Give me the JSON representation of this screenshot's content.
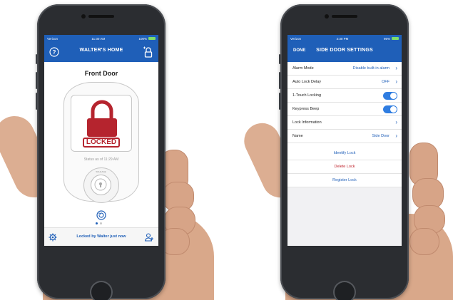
{
  "left_phone": {
    "status_bar": {
      "carrier": "Verizon",
      "time": "11:30 AM",
      "battery": "100%"
    },
    "header": {
      "title": "WALTER'S HOME",
      "left_icon": "help-icon",
      "right_icon": "add-lock-icon"
    },
    "lock": {
      "name": "Front Door",
      "state_label": "LOCKED",
      "status_text": "Status as of 11:29 AM",
      "keypad_label": "SCHLAGE"
    },
    "footer": {
      "status": "Locked by Walter just now",
      "left_icon": "gear-icon",
      "right_icon": "users-icon"
    },
    "pager": {
      "pages": 2,
      "active": 1
    }
  },
  "right_phone": {
    "status_bar": {
      "carrier": "Verizon",
      "time": "2:30 PM",
      "battery": "95%"
    },
    "header": {
      "done_label": "DONE",
      "title": "SIDE DOOR SETTINGS"
    },
    "settings": [
      {
        "label": "Alarm Mode",
        "value": "Disable built-in alarm",
        "control": "chevron"
      },
      {
        "label": "Auto Lock Delay",
        "value": "OFF",
        "control": "chevron"
      },
      {
        "label": "1-Touch Locking",
        "value": "",
        "control": "toggle",
        "on": true
      },
      {
        "label": "Keypress Beep",
        "value": "",
        "control": "toggle",
        "on": true
      },
      {
        "label": "Lock Information",
        "value": "",
        "control": "chevron"
      },
      {
        "label": "Name",
        "value": "Side Door",
        "control": "chevron"
      }
    ],
    "actions": [
      {
        "label": "Identify Lock",
        "color": "#1f5fb8"
      },
      {
        "label": "Delete Lock",
        "color": "#c0262f"
      },
      {
        "label": "Register Lock",
        "color": "#1f5fb8"
      }
    ]
  },
  "colors": {
    "brand_blue": "#1f5fb8",
    "locked_red": "#b5242e",
    "toggle_on": "#2f7de1"
  }
}
